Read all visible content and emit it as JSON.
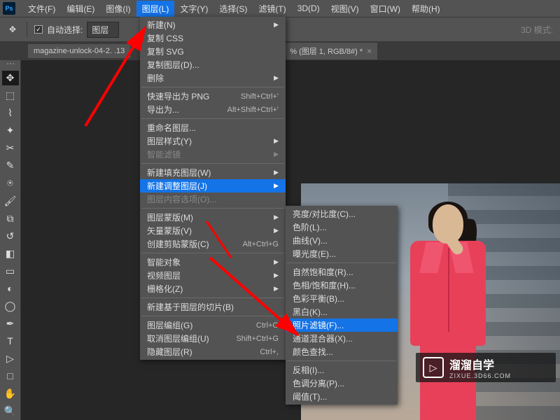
{
  "menubar": {
    "items": [
      "文件(F)",
      "编辑(E)",
      "图像(I)",
      "图层(L)",
      "文字(Y)",
      "选择(S)",
      "滤镜(T)",
      "3D(D)",
      "视图(V)",
      "窗口(W)",
      "帮助(H)"
    ],
    "active_index": 3
  },
  "optbar": {
    "auto_select_label": "自动选择:",
    "dropdown_value": "图层",
    "mode3d": "3D 模式:"
  },
  "tabs": {
    "tab1": "magazine-unlock-04-2.   .13",
    "tab2": "% (图层 1, RGB/8#) *"
  },
  "layer_menu": [
    {
      "label": "新建(N)",
      "arrow": true
    },
    {
      "label": "复制 CSS"
    },
    {
      "label": "复制 SVG"
    },
    {
      "label": "复制图层(D)..."
    },
    {
      "label": "删除",
      "arrow": true
    },
    {
      "sep": true
    },
    {
      "label": "快速导出为 PNG",
      "shortcut": "Shift+Ctrl+'"
    },
    {
      "label": "导出为...",
      "shortcut": "Alt+Shift+Ctrl+'"
    },
    {
      "sep": true
    },
    {
      "label": "重命名图层..."
    },
    {
      "label": "图层样式(Y)",
      "arrow": true
    },
    {
      "label": "智能滤镜",
      "disabled": true,
      "arrow": true
    },
    {
      "sep": true
    },
    {
      "label": "新建填充图层(W)",
      "arrow": true
    },
    {
      "label": "新建调整图层(J)",
      "highlight": true,
      "arrow": true
    },
    {
      "label": "图层内容选项(O)...",
      "disabled": true
    },
    {
      "sep": true
    },
    {
      "label": "图层蒙版(M)",
      "arrow": true
    },
    {
      "label": "矢量蒙版(V)",
      "arrow": true
    },
    {
      "label": "创建剪贴蒙版(C)",
      "shortcut": "Alt+Ctrl+G"
    },
    {
      "sep": true
    },
    {
      "label": "智能对象",
      "arrow": true
    },
    {
      "label": "视频图层",
      "arrow": true
    },
    {
      "label": "栅格化(Z)",
      "arrow": true
    },
    {
      "sep": true
    },
    {
      "label": "新建基于图层的切片(B)"
    },
    {
      "sep": true
    },
    {
      "label": "图层编组(G)",
      "shortcut": "Ctrl+G"
    },
    {
      "label": "取消图层编组(U)",
      "shortcut": "Shift+Ctrl+G"
    },
    {
      "label": "隐藏图层(R)",
      "shortcut": "Ctrl+,"
    }
  ],
  "adjustment_submenu": [
    {
      "label": "亮度/对比度(C)..."
    },
    {
      "label": "色阶(L)..."
    },
    {
      "label": "曲线(V)..."
    },
    {
      "label": "曝光度(E)..."
    },
    {
      "sep": true
    },
    {
      "label": "自然饱和度(R)..."
    },
    {
      "label": "色相/饱和度(H)..."
    },
    {
      "label": "色彩平衡(B)..."
    },
    {
      "label": "黑白(K)..."
    },
    {
      "label": "照片滤镜(F)...",
      "highlight": true
    },
    {
      "label": "通道混合器(X)..."
    },
    {
      "label": "颜色查找..."
    },
    {
      "sep": true
    },
    {
      "label": "反相(I)..."
    },
    {
      "label": "色调分离(P)..."
    },
    {
      "label": "阈值(T)..."
    }
  ],
  "watermark": {
    "title": "溜溜自学",
    "sub": "ZIXUE.3D66.COM"
  },
  "ps_logo": "Ps"
}
